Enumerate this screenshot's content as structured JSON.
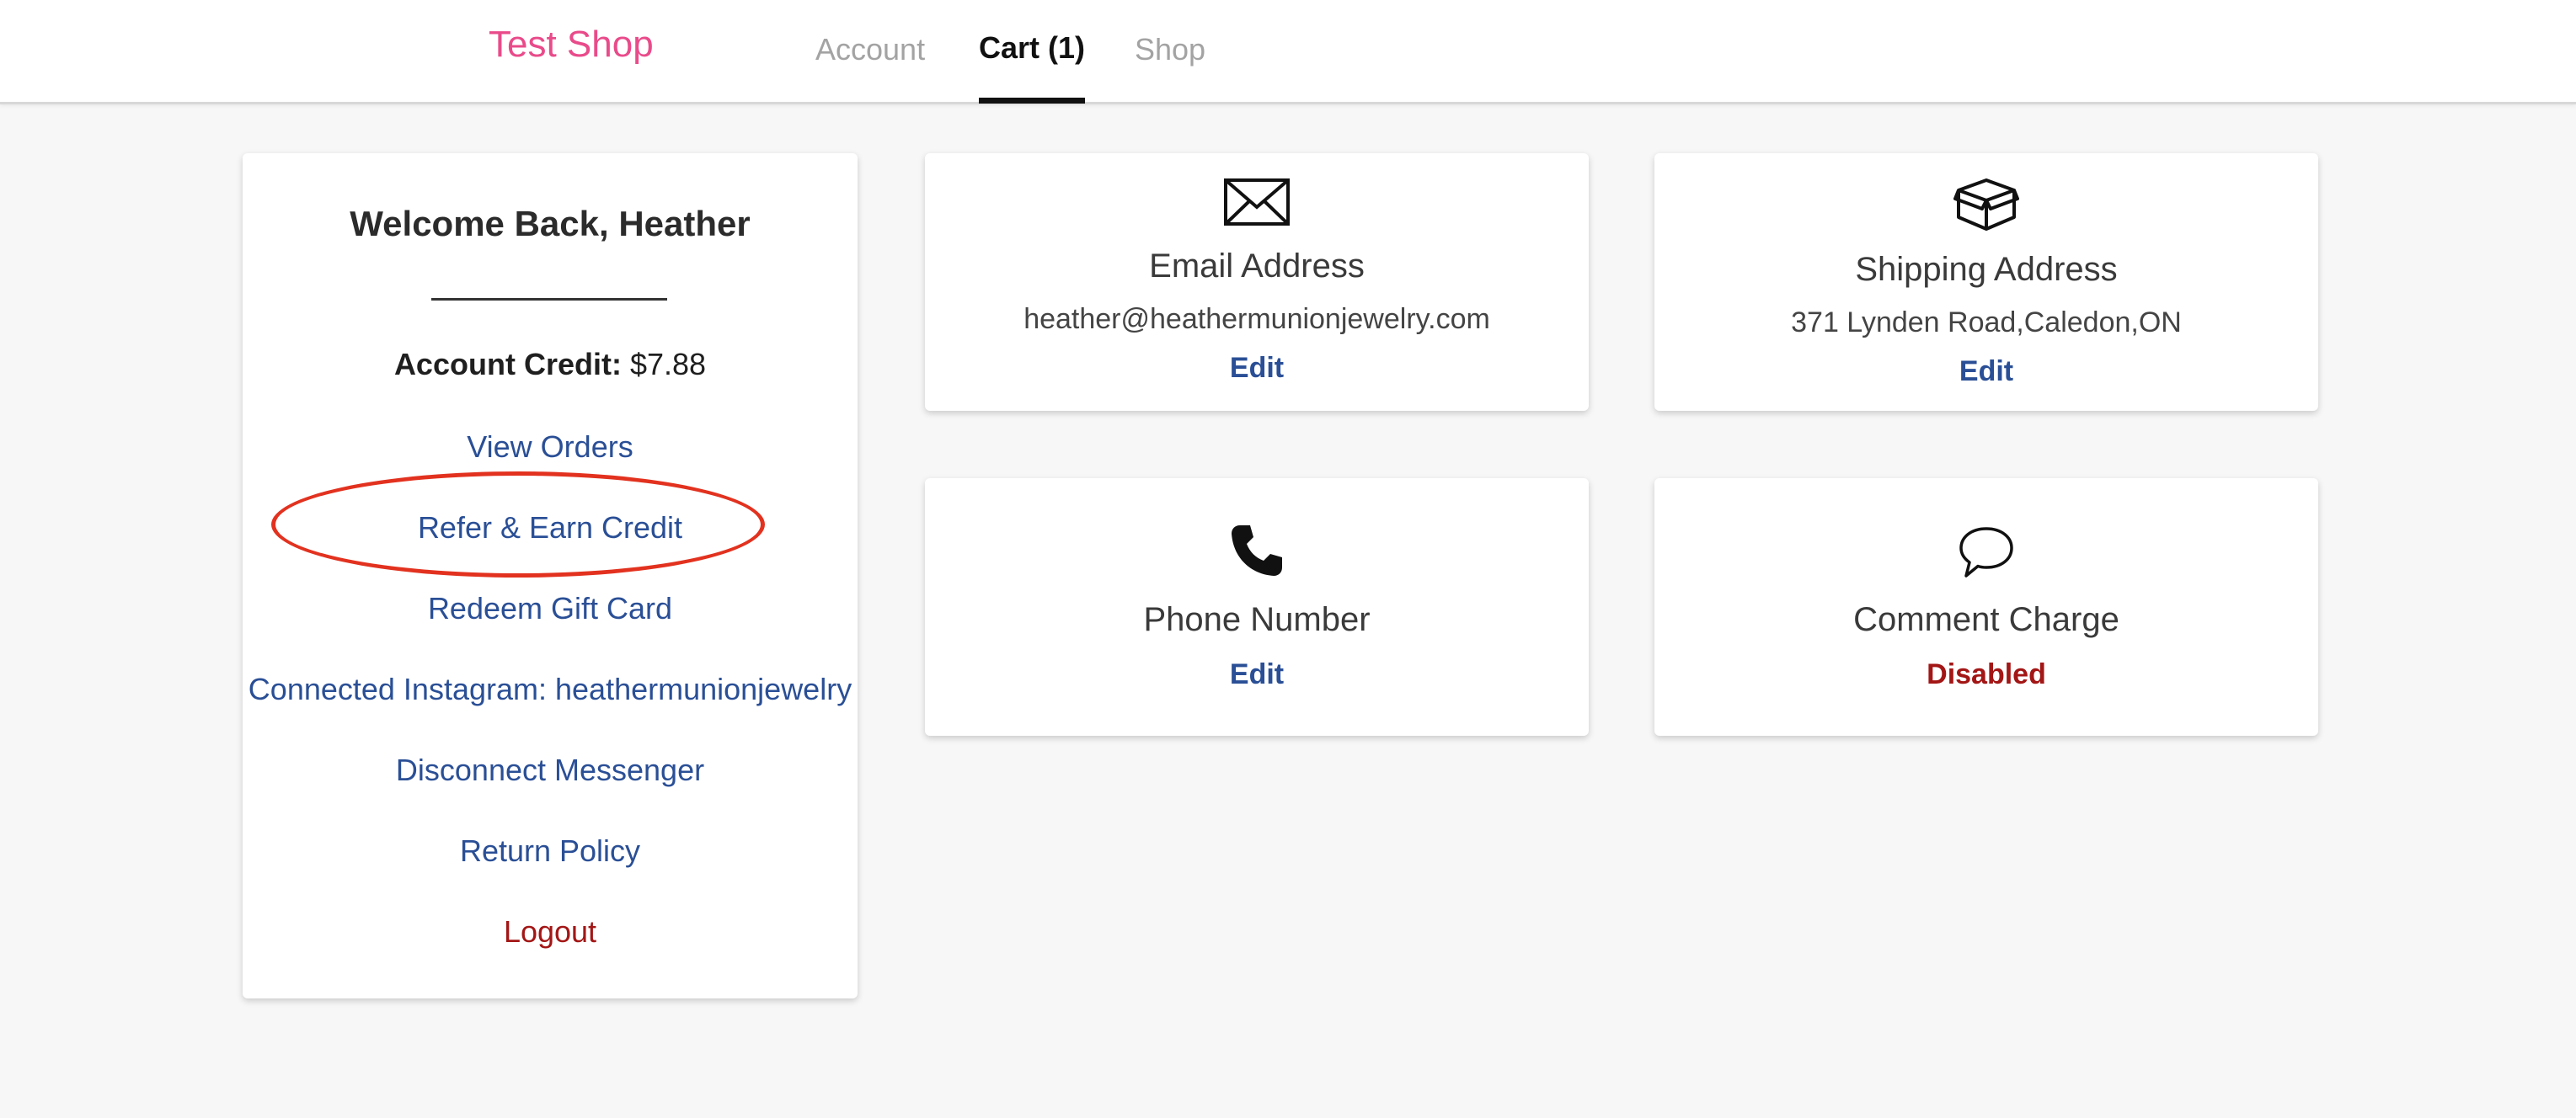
{
  "header": {
    "brand": "Test Shop",
    "tabs": [
      {
        "label": "Account"
      },
      {
        "label": "Cart (1)",
        "active": true
      },
      {
        "label": "Shop"
      }
    ]
  },
  "account": {
    "welcome": "Welcome Back, Heather",
    "credit_label": "Account Credit:",
    "credit_value": "$7.88",
    "links": [
      {
        "label": "View Orders"
      },
      {
        "label": "Refer & Earn Credit",
        "highlighted": true
      },
      {
        "label": "Redeem Gift Card"
      },
      {
        "label": "Connected Instagram: heathermunionjewelry"
      },
      {
        "label": "Disconnect Messenger"
      },
      {
        "label": "Return Policy"
      },
      {
        "label": "Logout"
      }
    ]
  },
  "cards": {
    "email": {
      "title": "Email Address",
      "value": "heather@heathermunionjewelry.com",
      "action": "Edit",
      "icon": "envelope-icon"
    },
    "shipping": {
      "title": "Shipping Address",
      "value": "371 Lynden Road,Caledon,ON",
      "action": "Edit",
      "icon": "box-icon"
    },
    "phone": {
      "title": "Phone Number",
      "action": "Edit",
      "icon": "phone-icon"
    },
    "comment": {
      "title": "Comment Charge",
      "status": "Disabled",
      "icon": "speech-bubble-icon"
    }
  },
  "colors": {
    "brand": "#e94b8a",
    "link": "#2a4f96",
    "danger": "#a31616",
    "highlight": "#e2321f"
  }
}
